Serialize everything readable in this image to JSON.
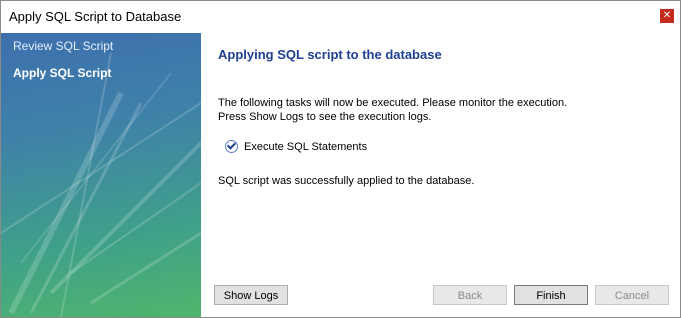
{
  "window": {
    "title": "Apply SQL Script to Database",
    "close_icon": "close-icon"
  },
  "sidebar": {
    "steps": [
      {
        "label": "Review SQL Script",
        "active": false
      },
      {
        "label": "Apply SQL Script",
        "active": true
      }
    ]
  },
  "content": {
    "heading": "Applying SQL script to the database",
    "description_line1": "The following tasks will now be executed. Please monitor the execution.",
    "description_line2": "Press Show Logs to see the execution logs.",
    "task_label": "Execute SQL Statements",
    "task_status_icon": "checkmark-icon",
    "result_text": "SQL script was successfully applied to the database."
  },
  "buttons": {
    "show_logs": "Show Logs",
    "back": "Back",
    "finish": "Finish",
    "cancel": "Cancel"
  },
  "colors": {
    "heading": "#1f3f93",
    "sidebar_gradient_start": "#3e6fae",
    "sidebar_gradient_end": "#4fb56b",
    "close_button": "#c42b1c"
  }
}
